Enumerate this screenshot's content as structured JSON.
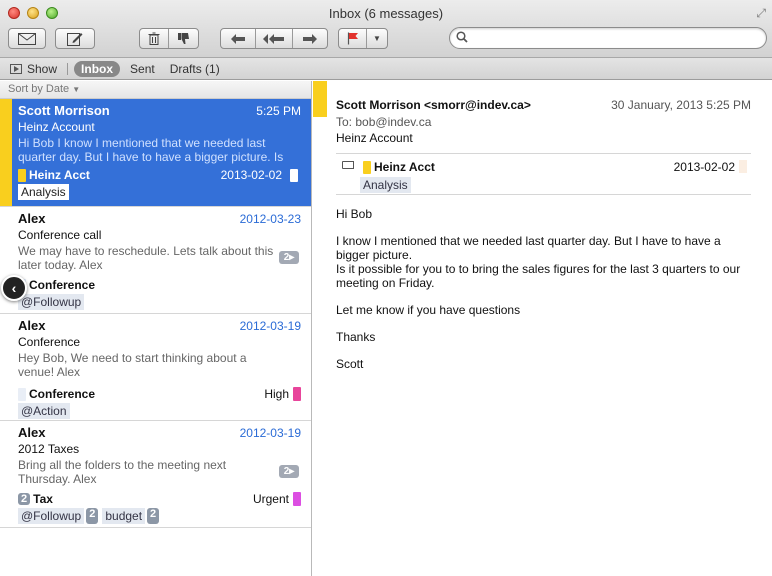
{
  "window": {
    "title": "Inbox (6 messages)"
  },
  "favorites": {
    "show": "Show",
    "inbox": "Inbox",
    "sent": "Sent",
    "drafts": "Drafts (1)"
  },
  "search": {
    "placeholder": ""
  },
  "sort": {
    "label": "Sort by Date"
  },
  "messages": [
    {
      "from": "Scott Morrison",
      "time": "5:25 PM",
      "subject": "Heinz Account",
      "preview": "Hi Bob I know I mentioned that we needed last quarter day. But I have to have a bigger picture. Is i…",
      "category": "Heinz Acct",
      "category_date": "2013-02-02",
      "tags": [
        "Analysis"
      ]
    },
    {
      "from": "Alex",
      "time": "2012-03-23",
      "subject": "Conference call",
      "preview": "We may have to reschedule. Lets talk about this later today. Alex",
      "thread": "2",
      "category": "Conference",
      "tags": [
        "@Followup"
      ]
    },
    {
      "from": "Alex",
      "time": "2012-03-19",
      "subject": "Conference",
      "preview": "Hey Bob, We need to start thinking about a venue! Alex",
      "category": "Conference",
      "priority": "High",
      "tags": [
        "@Action"
      ]
    },
    {
      "from": "Alex",
      "time": "2012-03-19",
      "subject": "2012 Taxes",
      "preview": "Bring all the folders to the meeting next Thursday. Alex",
      "thread": "2",
      "category_count": "2",
      "category": "Tax",
      "priority": "Urgent",
      "tags": [
        "@Followup",
        "budget"
      ],
      "tag_counts": [
        "2",
        "2"
      ]
    }
  ],
  "reader": {
    "from": "Scott Morrison <smorr@indev.ca>",
    "date": "30 January, 2013 5:25 PM",
    "to_label": "To:",
    "to": "bob@indev.ca",
    "subject": "Heinz Account",
    "category": "Heinz Acct",
    "category_date": "2013-02-02",
    "tag": "Analysis",
    "body": [
      "Hi Bob",
      "I know I mentioned that we needed last quarter day.   But I have to have a bigger picture.",
      "Is it possible for you to to bring the sales figures for the last 3 quarters to our meeting on Friday.",
      "Let me know if you have questions",
      "Thanks",
      "Scott"
    ]
  },
  "colors": {
    "selection": "#3470d8",
    "flag_yellow": "#f9cf1e",
    "priority_high": "#e8459b",
    "priority_urgent": "#dc4ee2",
    "date_blue": "#2a6bd6"
  }
}
